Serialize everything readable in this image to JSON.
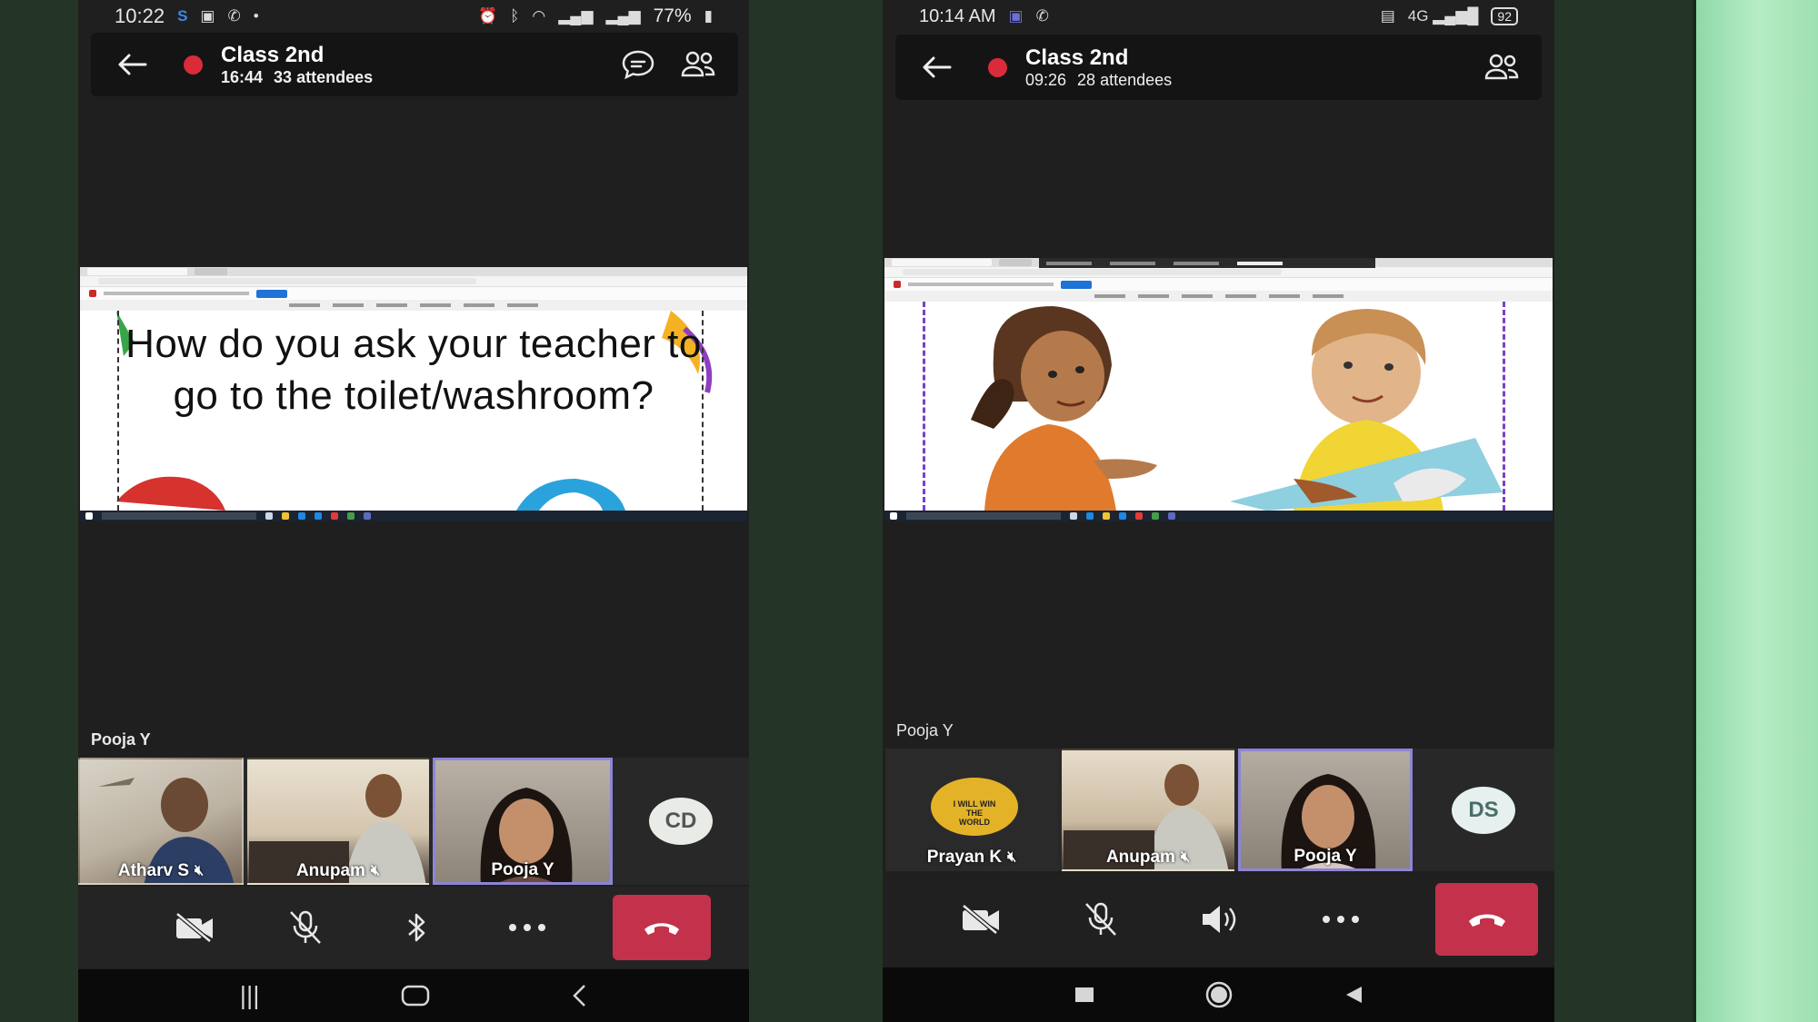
{
  "phones": [
    {
      "status": {
        "time": "10:22",
        "battery": "77%"
      },
      "meeting": {
        "title": "Class 2nd",
        "duration": "16:44",
        "attendees": "33 attendees"
      },
      "slide": {
        "text": "How do you ask your teacher to go to the toilet/washroom?"
      },
      "speaker": "Pooja Y",
      "participants": [
        {
          "name": "Atharv S"
        },
        {
          "name": "Anupam"
        },
        {
          "name": "Pooja Y"
        },
        {
          "initials": "CD"
        }
      ]
    },
    {
      "status": {
        "time": "10:14 AM",
        "battery": "92"
      },
      "meeting": {
        "title": "Class 2nd",
        "duration": "09:26",
        "attendees": "28 attendees"
      },
      "speaker": "Pooja Y",
      "participants": [
        {
          "name": "Prayan K",
          "avatar_text": "I WILL WIN THE WORLD"
        },
        {
          "name": "Anupam"
        },
        {
          "name": "Pooja Y"
        },
        {
          "initials": "DS"
        }
      ]
    }
  ],
  "colors": {
    "end_call": "#c4314b",
    "recording": "#d92b3a",
    "active_tile_border": "#8e85d6"
  },
  "icons": [
    "back-arrow-icon",
    "chat-icon",
    "people-icon",
    "camera-off-icon",
    "mic-off-icon",
    "bluetooth-icon",
    "more-icon",
    "end-call-icon",
    "speaker-icon",
    "recent-apps-icon",
    "home-icon",
    "nav-back-icon"
  ]
}
